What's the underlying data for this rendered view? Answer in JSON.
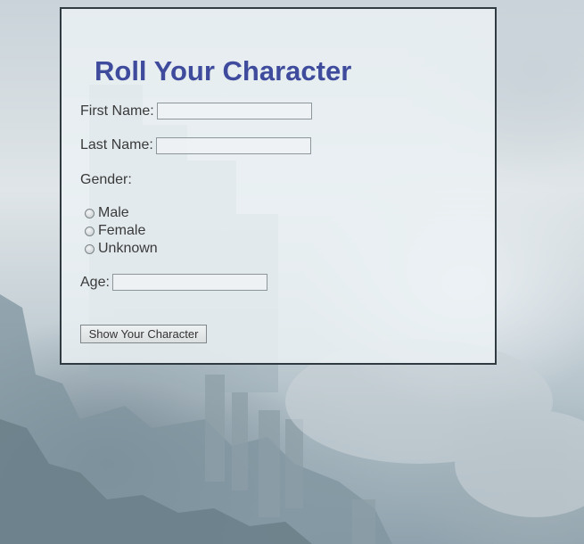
{
  "form": {
    "title": "Roll Your Character",
    "first_name_label": "First Name:",
    "first_name_value": "",
    "last_name_label": "Last Name:",
    "last_name_value": "",
    "gender_label": "Gender:",
    "gender_options": [
      {
        "label": "Male",
        "selected": false
      },
      {
        "label": "Female",
        "selected": false
      },
      {
        "label": "Unknown",
        "selected": false
      }
    ],
    "age_label": "Age:",
    "age_value": "",
    "submit_label": "Show Your Character"
  },
  "colors": {
    "title": "#3f4b9c",
    "card_border": "#2f3b40"
  }
}
